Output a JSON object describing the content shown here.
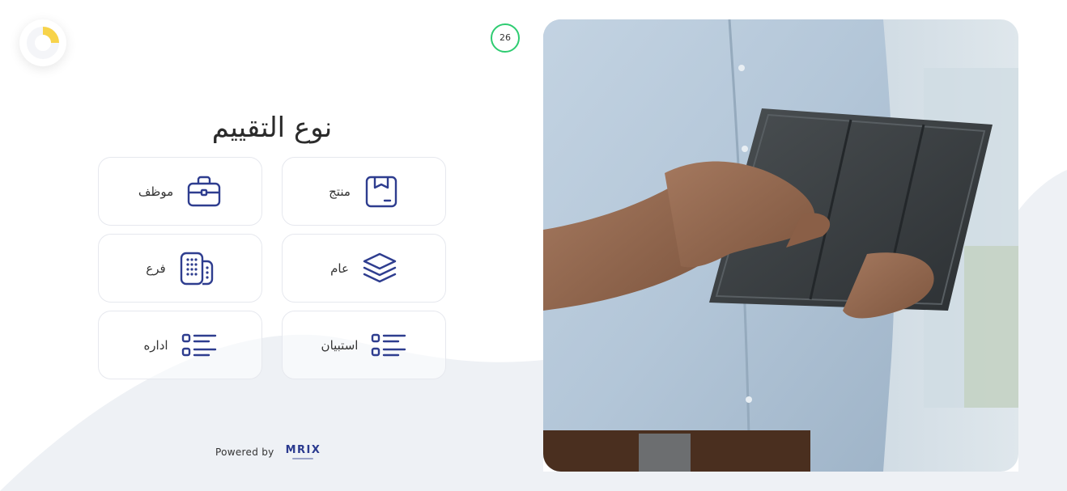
{
  "timer": {
    "value": "26",
    "color": "#2ecc71"
  },
  "loader": {
    "color": "#f7d34a",
    "icon": "loading-indicator-icon"
  },
  "page": {
    "title": "نوع التقييم"
  },
  "options": [
    {
      "id": "product",
      "label": "منتج",
      "icon": "box-icon"
    },
    {
      "id": "employee",
      "label": "موظف",
      "icon": "briefcase-icon"
    },
    {
      "id": "general",
      "label": "عام",
      "icon": "layers-icon"
    },
    {
      "id": "branch",
      "label": "فرع",
      "icon": "building-icon"
    },
    {
      "id": "survey",
      "label": "استبيان",
      "icon": "list-icon"
    },
    {
      "id": "management",
      "label": "اداره",
      "icon": "list-icon"
    }
  ],
  "footer": {
    "powered_by": "Powered by",
    "brand": "MRIX"
  },
  "theme": {
    "accent": "#2e3d8f",
    "card_border": "#e6e8ee",
    "wave": "#eef1f5"
  },
  "photo": {
    "icon": "person-holding-tablet-image"
  }
}
